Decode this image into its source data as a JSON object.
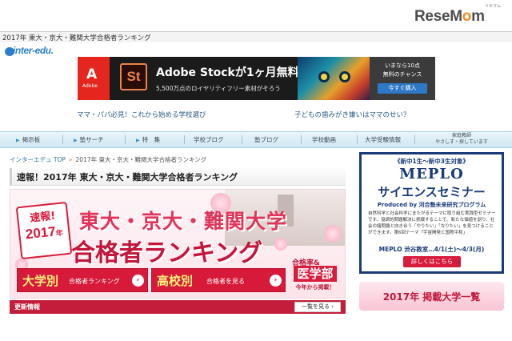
{
  "brand": {
    "name_pre": "ReseM",
    "name_o": "o",
    "name_post": "m",
    "tagline": "リセマム"
  },
  "page_title": "2017年 東大・京大・難関大学合格者ランキング",
  "logo": {
    "text": "inter-edu."
  },
  "ad": {
    "adobe_label": "Adobe",
    "icon": "St",
    "title_pre": "Adobe Stock",
    "title_mid": "が",
    "title_bold": "1ヶ月無料",
    "subtitle": "5,500万点のロイヤリティフリー素材がそろう",
    "right_line1": "いまなら10点",
    "right_line2": "無料のチャンス",
    "button": "今すぐ購入"
  },
  "promo": {
    "left": "ママ・パパ必見！これから始める学校選び",
    "right": "子どもの歯みがき嫌いはママのせい？"
  },
  "gnav": {
    "items": [
      "掲示板",
      "塾サーチ",
      "特　集",
      "学校ブログ",
      "塾ブログ",
      "学校動画",
      "大学受験情報"
    ],
    "item8_line1": "家庭教師",
    "item8_line2": "やさしす・探しています"
  },
  "breadcrumb": {
    "home": "インターエデュ TOP",
    "sep": "»",
    "current": "2017年 東大・京大・難関大学合格者ランキング"
  },
  "heading": "速報！2017年 東大・京大・難関大学合格者ランキング",
  "banner": {
    "sokuho1": "速報!",
    "sokuho2_num": "2017",
    "sokuho2_unit": "年",
    "title1": "東大・京大・難関大学",
    "title2": "合格者ランキング",
    "badge_top": "合格率&",
    "badge_main": "医学部",
    "badge_bottom": "今年から掲載！",
    "btn1_big": "大学別",
    "btn1_small": "合格者ランキング",
    "btn2_big": "高校別",
    "btn2_small": "合格者を見る",
    "chevron": "›"
  },
  "news": {
    "label": "更新情報",
    "more": "一覧を見る ›"
  },
  "side_ad": {
    "top_label": "《新中1生〜新中3生対象》",
    "meplo": "MEPLO",
    "science": "サイエンスセミナー",
    "produced": "Produced by 河合塾未来研究プログラム",
    "desc": "自然科学と社会科学にまたがるテーマに取り組む実践型セミナーです。協調的問題解決に挑戦することで、新たな価値を創り、社会の諸問題と向き合う「やりたい」「なりたい」を見つけることができます。第6回テーマ「宇宙開発と国際平和」",
    "venue": "MEPLO 渋谷教室…4/1(土)〜4/3(月)",
    "detail": "詳しくはこちら",
    "hand": "☝"
  },
  "side_list": "2017年 掲載大学一覧",
  "colors": {
    "accent_red": "#d71a3a",
    "navy": "#1b3a7a",
    "link_blue": "#2c5a8a"
  }
}
